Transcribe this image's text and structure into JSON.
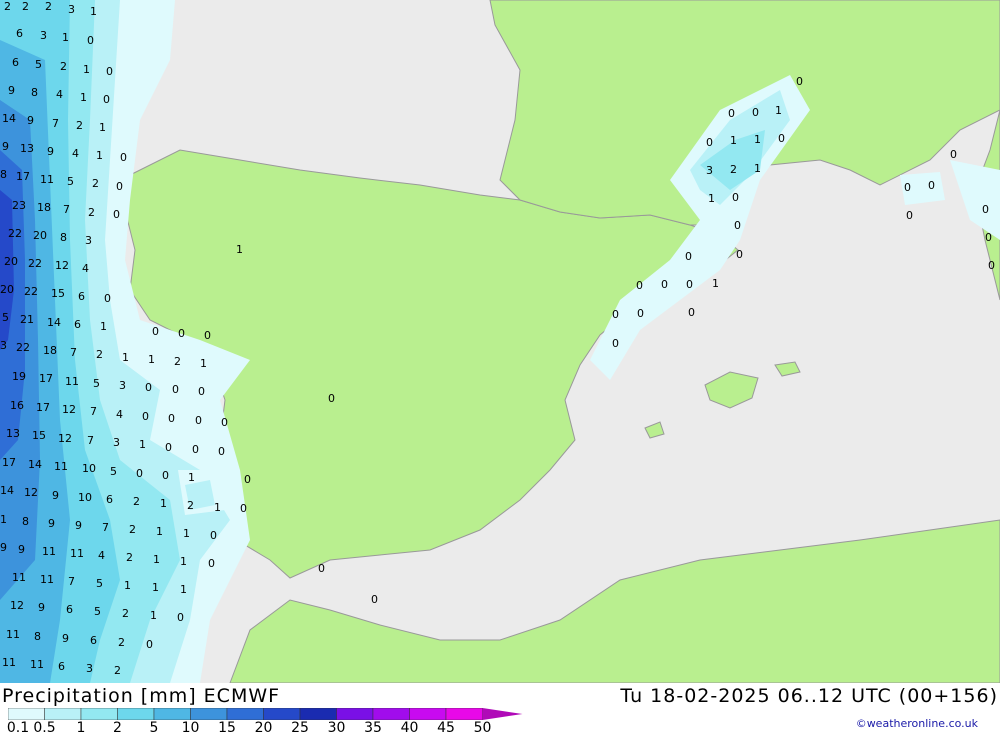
{
  "title": {
    "left": "Precipitation [mm] ECMWF",
    "right": "Tu 18-02-2025 06..12 UTC (00+156)"
  },
  "credit": "©weatheronline.co.uk",
  "legend": {
    "labels": [
      "0.1",
      "0.5",
      "1",
      "2",
      "5",
      "10",
      "15",
      "20",
      "25",
      "30",
      "35",
      "40",
      "45",
      "50"
    ],
    "colors": [
      "#dffafd",
      "#b9f1f7",
      "#93e8f1",
      "#6dd7ec",
      "#4fb7e4",
      "#3d93dc",
      "#2f6ed6",
      "#2549c9",
      "#1a2bb0",
      "#7a10e6",
      "#a10cec",
      "#c80af0",
      "#e808e8",
      "#b00ab8"
    ]
  },
  "map": {
    "land_color": "#b9ef8f",
    "sea_color": "#ebebeb",
    "precip_values": [
      [
        "2",
        "2",
        "3",
        "1"
      ],
      [
        "6",
        "3",
        "1",
        "0"
      ],
      [
        "6",
        "5",
        "2",
        "1",
        "0"
      ],
      [
        "9",
        "8",
        "4",
        "1",
        "0"
      ],
      [
        "14",
        "9",
        "7",
        "2",
        "1"
      ],
      [
        "9",
        "13",
        "9",
        "4",
        "1",
        "0"
      ],
      [
        "8",
        "17",
        "11",
        "5",
        "2",
        "0"
      ],
      [
        "23",
        "18",
        "7",
        "2",
        "0"
      ],
      [
        "22",
        "20",
        "8",
        "3"
      ],
      [
        "20",
        "22",
        "12",
        "4"
      ],
      [
        "20",
        "22",
        "15",
        "6",
        "0"
      ],
      [
        "5",
        "21",
        "14",
        "6",
        "1"
      ],
      [
        "3",
        "22",
        "18",
        "7",
        "2",
        "1",
        "1",
        "2",
        "1"
      ],
      [
        "19",
        "17",
        "11",
        "5",
        "3",
        "0",
        "0",
        "0"
      ],
      [
        "16",
        "17",
        "12",
        "7",
        "4",
        "0",
        "0",
        "0",
        "0"
      ],
      [
        "13",
        "15",
        "12",
        "7",
        "3",
        "1",
        "0",
        "0",
        "0"
      ],
      [
        "17",
        "14",
        "11",
        "10",
        "5",
        "0",
        "0",
        "1",
        "0"
      ],
      [
        "14",
        "12",
        "9",
        "10",
        "6",
        "2",
        "1",
        "2",
        "1",
        "0"
      ],
      [
        "1",
        "8",
        "9",
        "9",
        "7",
        "2",
        "1",
        "1",
        "0"
      ],
      [
        "9",
        "11",
        "11",
        "4",
        "2",
        "1",
        "1",
        "0"
      ],
      [
        "11",
        "11",
        "7",
        "5",
        "1",
        "1",
        "1"
      ],
      [
        "12",
        "9",
        "6",
        "5",
        "2",
        "1",
        "0"
      ],
      [
        "11",
        "8",
        "9",
        "6",
        "2",
        "0"
      ],
      [
        "11",
        "11",
        "6",
        "3",
        "2"
      ],
      [
        "0",
        "0",
        "0",
        "0",
        "1",
        "1",
        "1",
        "0",
        "1",
        "0"
      ],
      [
        "3",
        "2",
        "1",
        "1",
        "0",
        "0",
        "0",
        "0",
        "0",
        "0"
      ],
      [
        "0",
        "0",
        "1",
        "0",
        "0",
        "0",
        "0",
        "0",
        "0",
        "0"
      ]
    ]
  }
}
